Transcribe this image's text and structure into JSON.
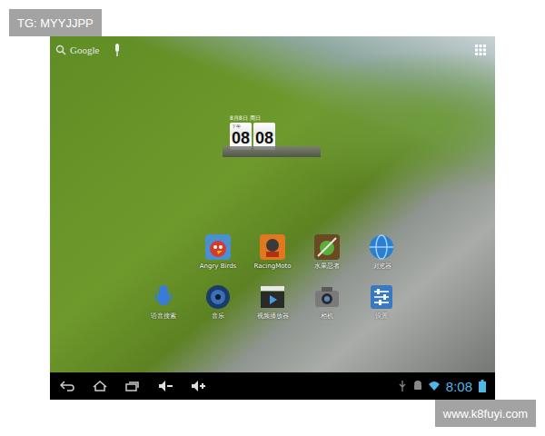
{
  "watermarks": {
    "top": "TG: MYYJJPP",
    "bottom": "www.k8fuyi.com"
  },
  "search": {
    "label": "Google"
  },
  "clock_widget": {
    "date": "8月8日 周日",
    "period": "下午",
    "hour": "08",
    "minute": "08"
  },
  "apps_row1": [
    {
      "label": "Angry Birds",
      "kind": "birds"
    },
    {
      "label": "RacingMoto",
      "kind": "moto"
    },
    {
      "label": "水果忍者",
      "kind": "fruit"
    },
    {
      "label": "浏览器",
      "kind": "browser"
    }
  ],
  "apps_row2": [
    {
      "label": "语音搜索",
      "kind": "voice"
    },
    {
      "label": "音乐",
      "kind": "music"
    },
    {
      "label": "视频播放器",
      "kind": "video"
    },
    {
      "label": "相机",
      "kind": "camera"
    },
    {
      "label": "设置",
      "kind": "settings"
    }
  ],
  "status_bar": {
    "time": "8:08"
  }
}
